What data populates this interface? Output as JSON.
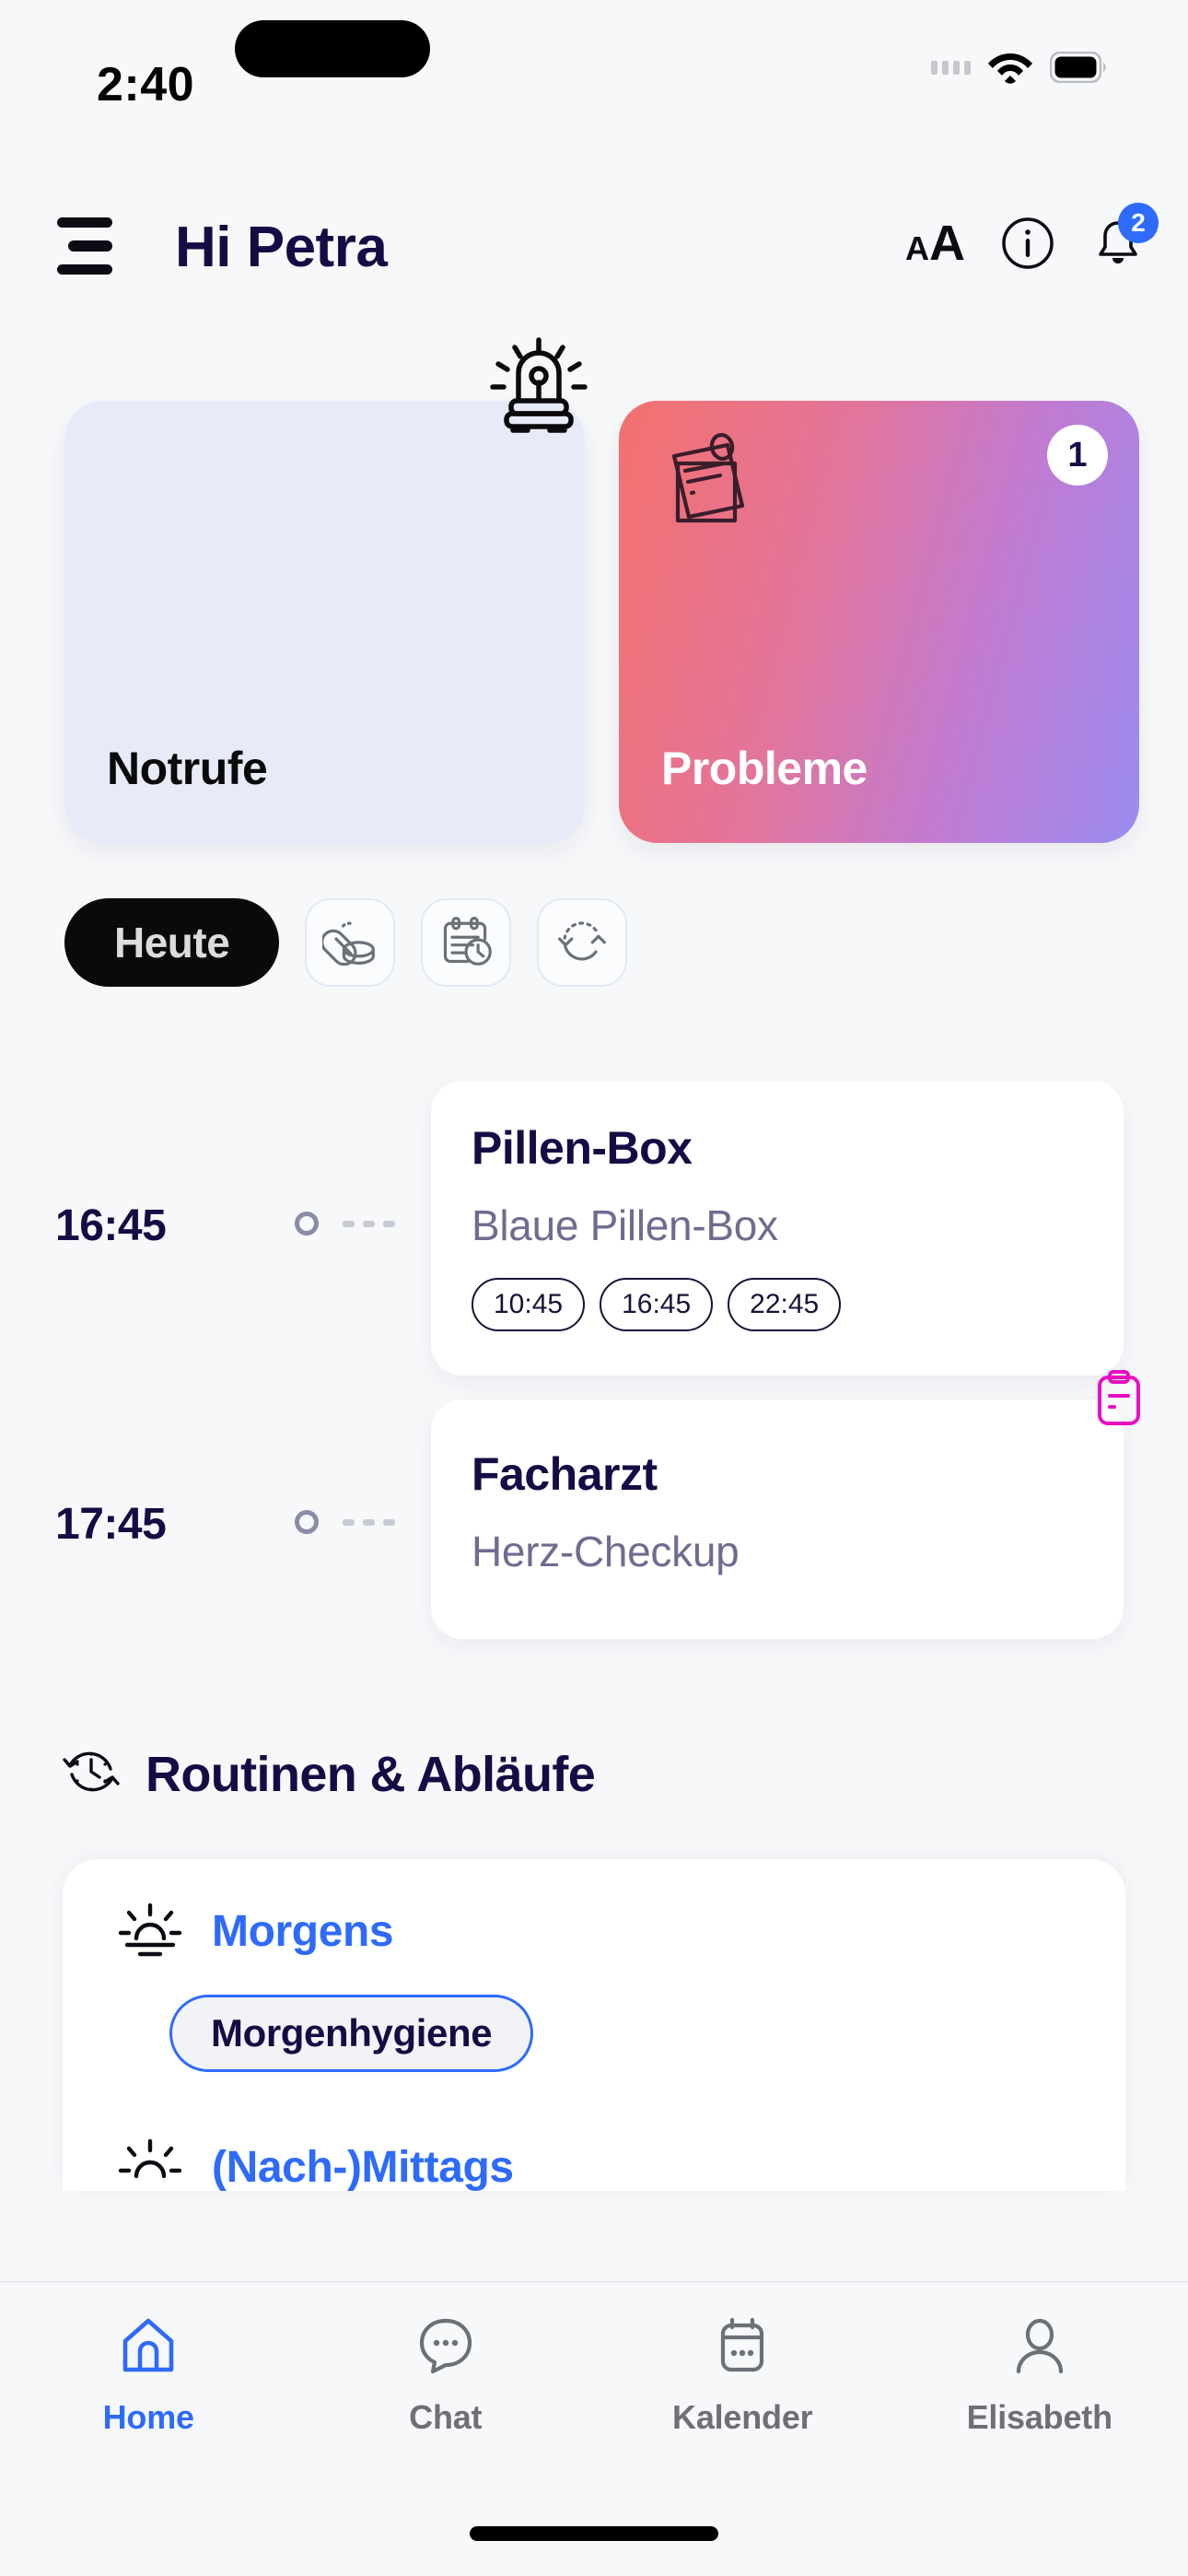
{
  "status_bar": {
    "time": "2:40",
    "signal_icon": "signal-dots-icon",
    "wifi_icon": "wifi-icon",
    "battery_icon": "battery-icon"
  },
  "header": {
    "menu_icon": "hamburger-menu-icon",
    "greeting": "Hi Petra",
    "text_size_icon_small": "A",
    "text_size_icon_large": "A",
    "info_icon": "info-circle-icon",
    "bell_icon": "bell-icon",
    "bell_badge": "2"
  },
  "hero_cards": [
    {
      "label": "Notrufe",
      "icon": "emergency-siren-icon",
      "bg": "#e7ebf7",
      "text_color": "#0a0a0a"
    },
    {
      "label": "Probleme",
      "icon": "pinned-note-icon",
      "badge": "1",
      "gradient_from": "#f4706d",
      "gradient_to": "#9b8cf0",
      "text_color": "#ffffff"
    }
  ],
  "filters": {
    "active_chip": "Heute",
    "icon_chips": [
      {
        "icon": "pills-medication-icon"
      },
      {
        "icon": "calendar-clock-icon"
      },
      {
        "icon": "refresh-recurring-icon"
      }
    ]
  },
  "timeline": [
    {
      "time": "16:45",
      "title": "Pillen-Box",
      "subtitle": "Blaue Pillen-Box",
      "time_pills": [
        "10:45",
        "16:45",
        "22:45"
      ]
    },
    {
      "time": "17:45",
      "title": "Facharzt",
      "subtitle": "Herz-Checkup",
      "corner_icon": "clipboard-icon",
      "corner_icon_color": "#e90ec4"
    }
  ],
  "routines": {
    "section_icon": "clock-history-icon",
    "section_title": "Routinen & Abläufe",
    "blocks": [
      {
        "icon": "sunrise-icon",
        "name": "Morgens",
        "accent": "#2e6bfb",
        "chips": [
          "Morgenhygiene"
        ]
      },
      {
        "icon": "sun-icon",
        "name": "(Nach-)Mittags",
        "accent": "#2e6bfb",
        "chips": []
      }
    ]
  },
  "bottom_nav": {
    "items": [
      {
        "label": "Home",
        "icon": "home-icon",
        "active": true
      },
      {
        "label": "Chat",
        "icon": "chat-bubble-icon",
        "active": false
      },
      {
        "label": "Kalender",
        "icon": "calendar-icon",
        "active": false
      },
      {
        "label": "Elisabeth",
        "icon": "user-profile-icon",
        "active": false
      }
    ]
  }
}
